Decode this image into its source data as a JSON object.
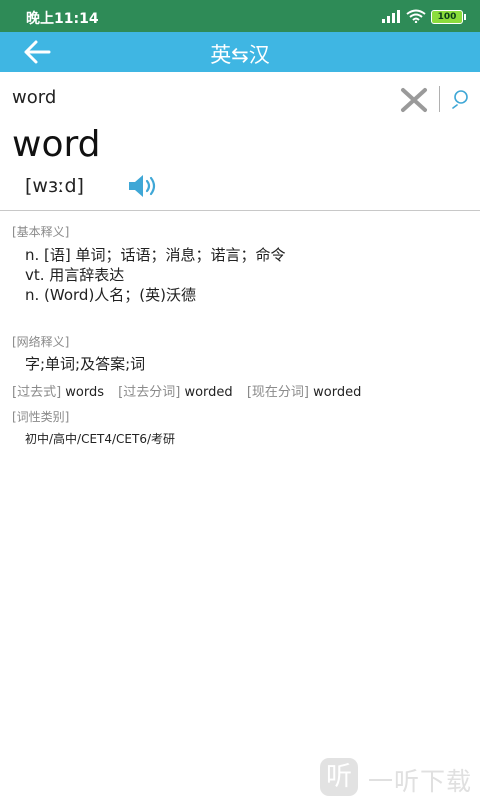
{
  "status_bar": {
    "time": "晚上11:14",
    "battery": "100"
  },
  "app_bar": {
    "title": "英⇆汉"
  },
  "search": {
    "value": "word"
  },
  "entry": {
    "headword": "word",
    "phonetic": "[wɜːd]"
  },
  "basic": {
    "label": "[基本释义]",
    "lines": [
      "n. [语] 单词；话语；消息；诺言；命令",
      "vt. 用言辞表达",
      "n. (Word)人名；(英)沃德"
    ]
  },
  "web": {
    "label": "[网络释义]",
    "lines": [
      "字;单词;及答案;词"
    ]
  },
  "forms": [
    {
      "label": "[过去式]",
      "value": "words"
    },
    {
      "label": "[过去分词]",
      "value": "worded"
    },
    {
      "label": "[现在分词]",
      "value": "worded"
    }
  ],
  "category": {
    "label": "[词性类别]",
    "value": "初中/高中/CET4/CET6/考研"
  },
  "watermark": {
    "icon_char": "听",
    "text": "一听下载"
  },
  "colors": {
    "status_bar": "#2e8b57",
    "app_bar": "#3fb6e3",
    "accent": "#3fa7d6"
  },
  "icons": [
    "back-arrow-icon",
    "clear-icon",
    "search-icon",
    "speaker-icon",
    "signal-icon",
    "wifi-icon",
    "battery-icon"
  ]
}
